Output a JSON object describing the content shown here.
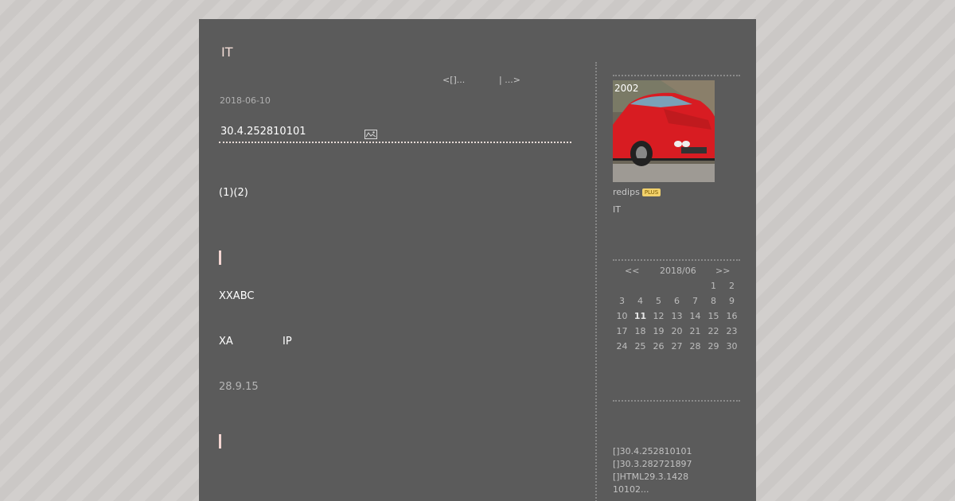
{
  "blog": {
    "title": "IT"
  },
  "pager": {
    "prev": "<[]...",
    "next": "| ...>"
  },
  "entry": {
    "date": "2018-06-10",
    "title": "30.4.252810101",
    "line1": "(1)(2)",
    "line2": "XXABC",
    "line3a": "XA",
    "line3b": "IP",
    "line4": "28.9.15"
  },
  "profile": {
    "image_label": "2002",
    "username": "redips",
    "badge": "PLUS",
    "description": "IT"
  },
  "calendar": {
    "prev": "<<",
    "month": "2018/06",
    "next": ">>",
    "weeks": [
      [
        "",
        "",
        "",
        "",
        "",
        "1",
        "2"
      ],
      [
        "3",
        "4",
        "5",
        "6",
        "7",
        "8",
        "9"
      ],
      [
        "10",
        "11",
        "12",
        "13",
        "14",
        "15",
        "16"
      ],
      [
        "17",
        "18",
        "19",
        "20",
        "21",
        "22",
        "23"
      ],
      [
        "24",
        "25",
        "26",
        "27",
        "28",
        "29",
        "30"
      ]
    ],
    "highlight": "11"
  },
  "recent_entries": [
    "[]30.4.252810101",
    "[]30.3.282721897",
    "[]HTML29.3.1428",
    "10102..."
  ],
  "colors": {
    "page_bg": "#5b5b5b",
    "accent": "#f4d6d2",
    "car_red": "#d81c22"
  }
}
